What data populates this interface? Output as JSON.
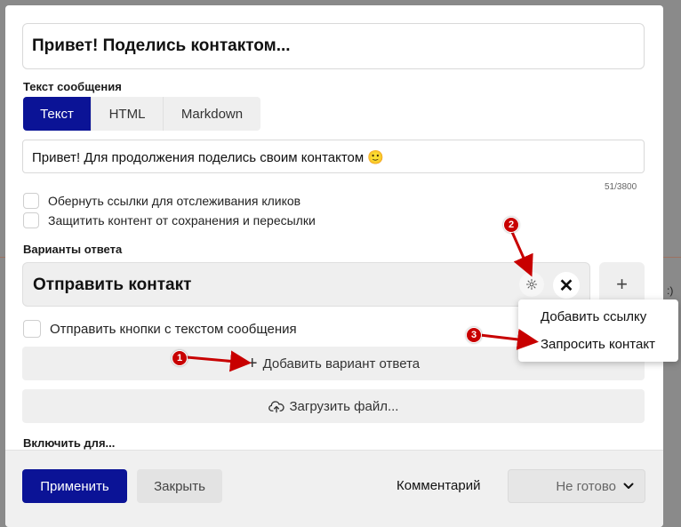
{
  "title_input": {
    "value": "Привет! Поделись контактом..."
  },
  "message_section": {
    "label": "Текст сообщения",
    "tabs": [
      {
        "label": "Текст",
        "active": true
      },
      {
        "label": "HTML",
        "active": false
      },
      {
        "label": "Markdown",
        "active": false
      }
    ],
    "message_value": "Привет! Для продолжения поделись своим контактом 🙂",
    "char_count": "51/3800"
  },
  "options": {
    "wrap_links": "Обернуть ссылки для отслеживания кликов",
    "protect_content": "Защитить контент от сохранения и пересылки"
  },
  "answers": {
    "label": "Варианты ответа",
    "items": [
      {
        "text": "Отправить контакт"
      }
    ],
    "add_side_label": "+",
    "send_buttons_with_text": "Отправить кнопки с текстом сообщения",
    "add_answer": "Добавить вариант ответа",
    "upload_file": "Загрузить файл..."
  },
  "enable_for": {
    "label": "Включить для..."
  },
  "dropdown": {
    "items": [
      "Добавить ссылку",
      "Запросить контакт"
    ]
  },
  "footer": {
    "apply": "Применить",
    "close": "Закрыть",
    "comment": "Комментарий",
    "status": "Не готово"
  },
  "annotations": {
    "badges": [
      "1",
      "2",
      "3"
    ],
    "color": "#c80000"
  },
  "colors": {
    "accent": "#0b1396",
    "annotation": "#c80000"
  }
}
